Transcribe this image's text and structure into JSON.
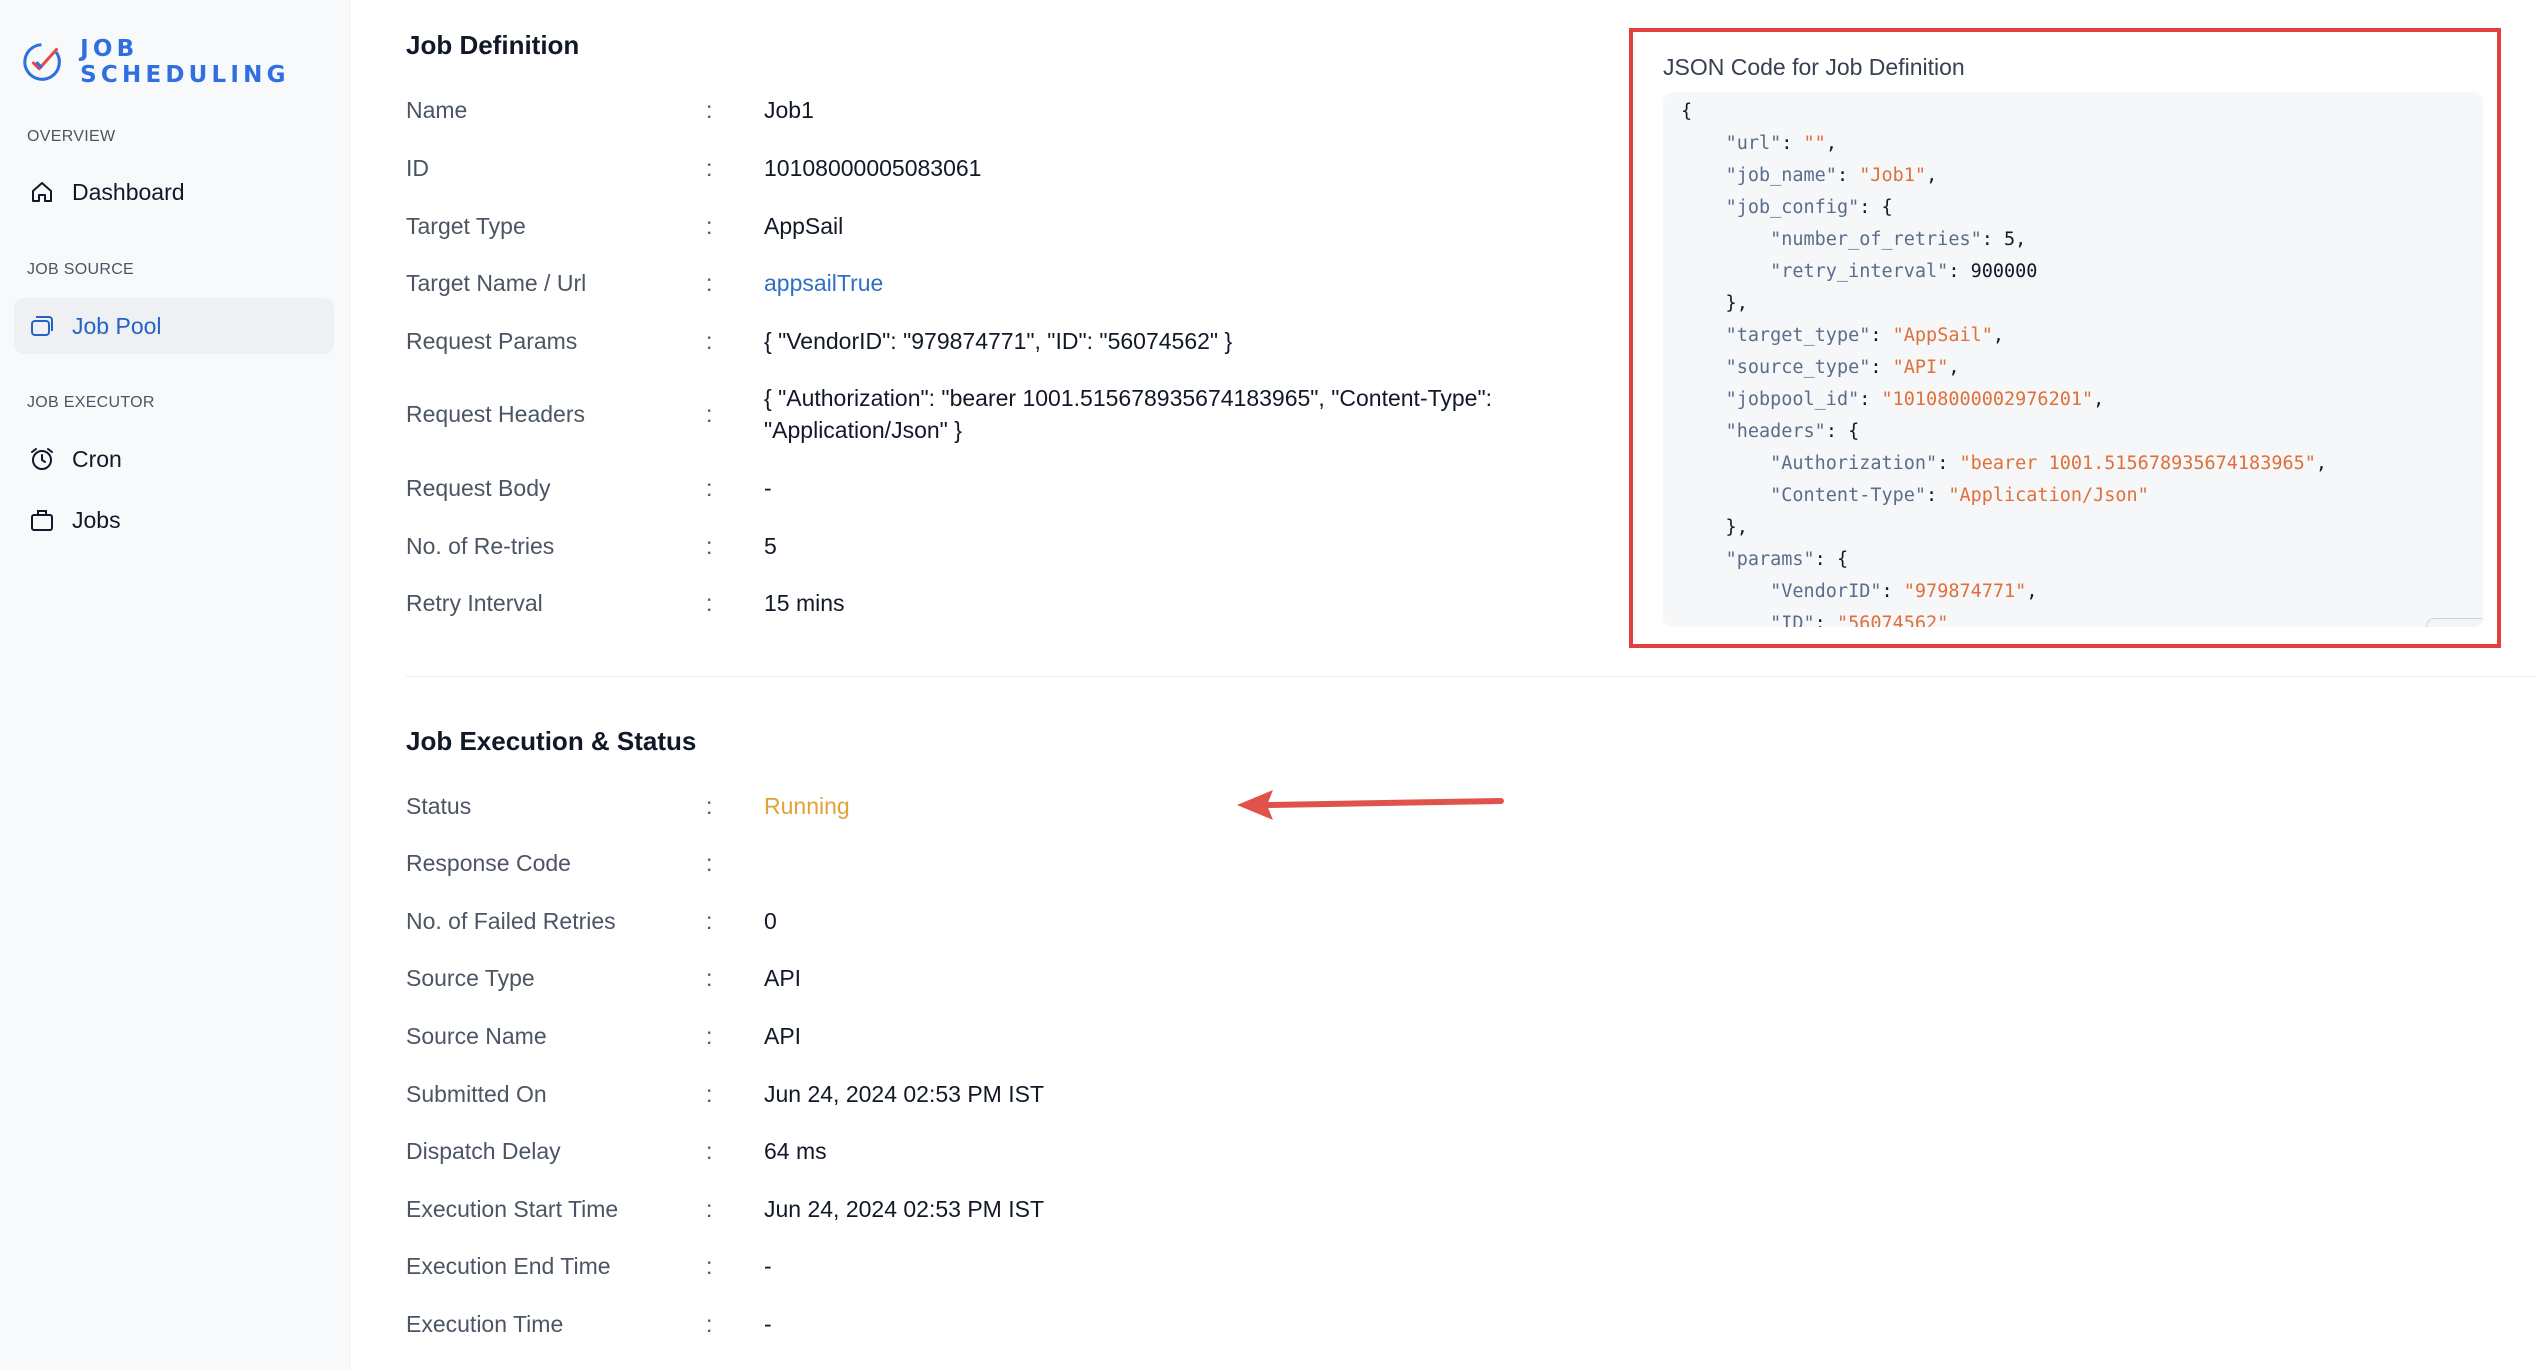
{
  "brand": {
    "name": "JOB SCHEDULING"
  },
  "sidebar": {
    "sections": [
      {
        "label": "OVERVIEW"
      },
      {
        "label": "JOB SOURCE"
      },
      {
        "label": "JOB EXECUTOR"
      }
    ],
    "items": [
      {
        "label": "Dashboard",
        "icon": "home-icon"
      },
      {
        "label": "Job Pool",
        "icon": "layers-icon",
        "active": true
      },
      {
        "label": "Cron",
        "icon": "alarm-clock-icon"
      },
      {
        "label": "Jobs",
        "icon": "briefcase-icon"
      }
    ]
  },
  "job_definition": {
    "title": "Job Definition",
    "fields": [
      {
        "label": "Name",
        "value": "Job1"
      },
      {
        "label": "ID",
        "value": "10108000005083061"
      },
      {
        "label": "Target Type",
        "value": "AppSail"
      },
      {
        "label": "Target Name / Url",
        "value": "appsailTrue"
      },
      {
        "label": "Request Params",
        "value": "{ \"VendorID\": \"979874771\", \"ID\": \"56074562\" }"
      },
      {
        "label": "Request Headers",
        "value": "{ \"Authorization\": \"bearer 1001.515678935674183965\", \"Content-Type\": \"Application/Json\" }"
      },
      {
        "label": "Request Body",
        "value": "-"
      },
      {
        "label": "No. of Re-tries",
        "value": "5"
      },
      {
        "label": "Retry Interval",
        "value": "15 mins"
      }
    ]
  },
  "json_panel": {
    "title": "JSON Code for Job Definition",
    "copy_icon": "copy-icon"
  },
  "job_execution": {
    "title": "Job Execution & Status",
    "fields": [
      {
        "label": "Status",
        "value": "Running"
      },
      {
        "label": "Response Code",
        "value": ""
      },
      {
        "label": "No. of Failed Retries",
        "value": "0"
      },
      {
        "label": "Source Type",
        "value": "API"
      },
      {
        "label": "Source Name",
        "value": "API"
      },
      {
        "label": "Submitted On",
        "value": "Jun 24, 2024 02:53 PM IST"
      },
      {
        "label": "Dispatch Delay",
        "value": "64 ms"
      },
      {
        "label": "Execution Start Time",
        "value": "Jun 24, 2024 02:53 PM IST"
      },
      {
        "label": "Execution End Time",
        "value": "-"
      },
      {
        "label": "Execution Time",
        "value": "-"
      }
    ]
  },
  "colors": {
    "accent": "#2f6fe0",
    "running": "#e0a33a",
    "highlight": "#e0413c"
  }
}
